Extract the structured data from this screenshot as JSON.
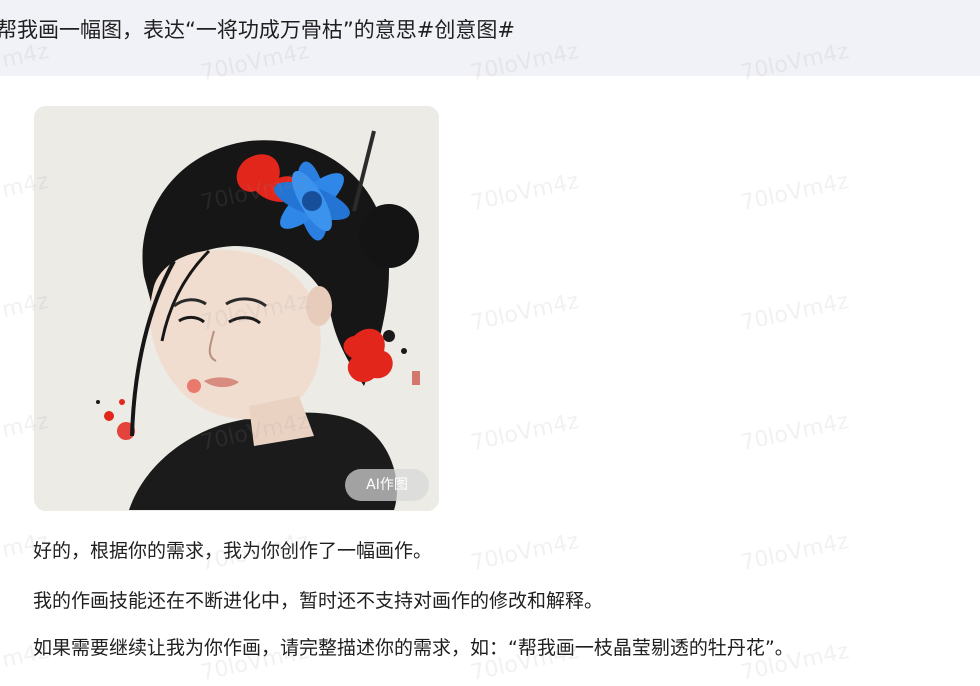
{
  "user_message": {
    "text": "帮我画一幅图，表达“一将功成万骨枯”的意思#创意图#"
  },
  "generated_image": {
    "badge": "AI作图",
    "subject": "ink-wash portrait of a young girl with blue and red flowers in her hair",
    "colors": {
      "background": "#ecebe6",
      "hair": "#1a1a1a",
      "flower_blue": "#2a7fe0",
      "flower_red": "#e2261c"
    }
  },
  "reply": {
    "line1": "好的，根据你的需求，我为你创作了一幅画作。",
    "line2": "我的作画技能还在不断进化中，暂时还不支持对画作的修改和解释。",
    "line3": "如果需要继续让我为你作画，请完整描述你的需求，如：“帮我画一枝晶莹剔透的牡丹花”。"
  },
  "watermark": {
    "text": "70loVm4z"
  }
}
